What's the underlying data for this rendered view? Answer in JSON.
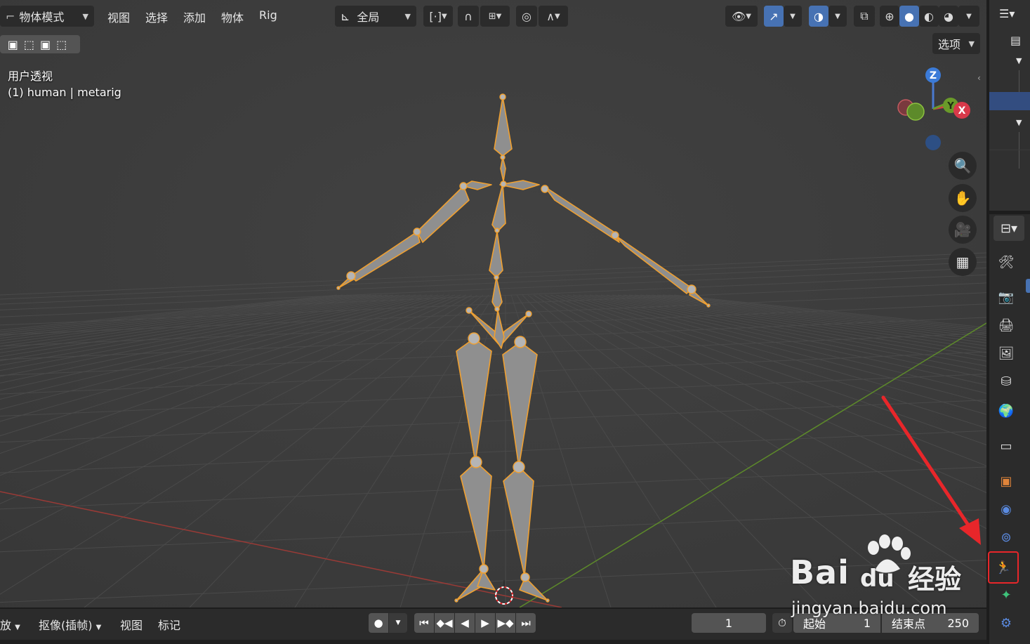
{
  "header": {
    "mode_label": "物体模式",
    "menus": [
      "视图",
      "选择",
      "添加",
      "物体",
      "Rig"
    ],
    "transform_orientation": "全局",
    "options_label": "选项"
  },
  "viewport": {
    "view_name": "用户透视",
    "object_info": "(1) human | metarig",
    "gizmo": {
      "z": "Z",
      "y": "Y",
      "x": "X"
    }
  },
  "timeline": {
    "playback_label": "回放",
    "keying_label": "抠像(插帧)",
    "view_label": "视图",
    "marker_label": "标记",
    "current_frame": "1",
    "start_label": "起始",
    "start_value": "1",
    "end_label": "结束点",
    "end_value": "250"
  },
  "watermark": {
    "brand": "Bai",
    "brand_cn": "经验",
    "url": "jingyan.baidu.com"
  },
  "colors": {
    "viewport_bg": "#3d3d3d",
    "bone_outline": "#f0a030",
    "bone_fill": "#8a8a8a",
    "active_blue": "#4772b3",
    "highlight_red": "#e8262a",
    "axis_x": "#b8443c",
    "axis_y": "#6a9a2a"
  }
}
